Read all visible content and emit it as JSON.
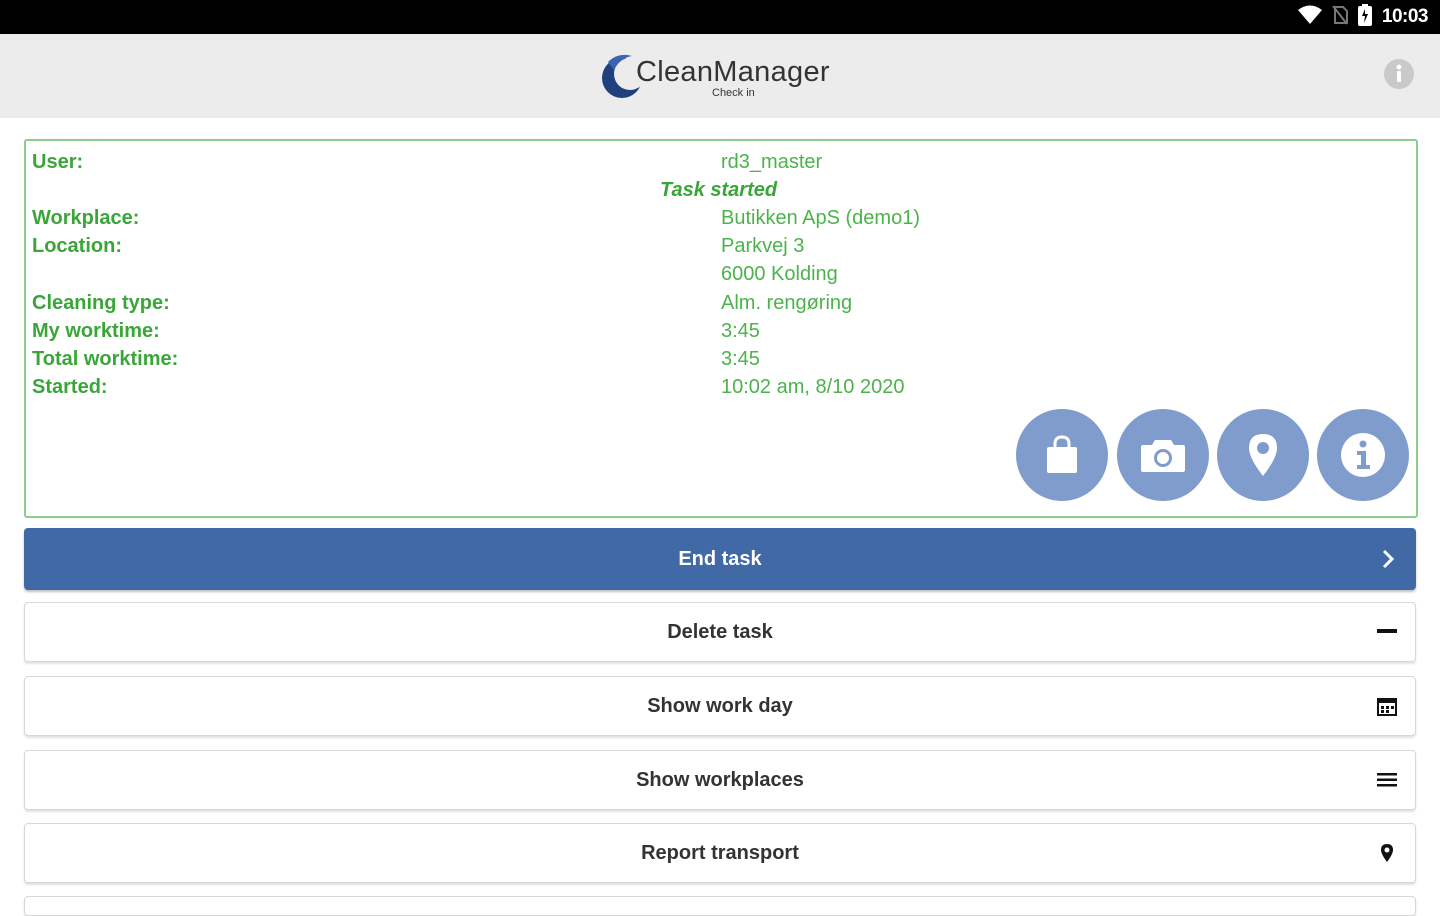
{
  "status_bar": {
    "time": "10:03",
    "icons": [
      "wifi-icon",
      "no-sim-icon",
      "battery-icon"
    ]
  },
  "header": {
    "logo_word": "CleanManager",
    "logo_subtitle": "Check in",
    "info_icon": "info-icon"
  },
  "task": {
    "status": "Task started",
    "fields": [
      {
        "label": "User:",
        "value": "rd3_master"
      },
      {
        "label": "Workplace:",
        "value": "Butikken ApS (demo1)"
      },
      {
        "label": "Location:",
        "value": "Parkvej 3"
      },
      {
        "label": "",
        "value": "6000 Kolding"
      },
      {
        "label": "Cleaning type:",
        "value": "Alm. rengøring"
      },
      {
        "label": "My worktime:",
        "value": "3:45"
      },
      {
        "label": "Total worktime:",
        "value": "3:45"
      },
      {
        "label": "Started:",
        "value": "10:02 am, 8/10 2020"
      }
    ],
    "quick_actions": [
      "shopping-bag-icon",
      "camera-icon",
      "map-pin-icon",
      "info-icon"
    ]
  },
  "actions": [
    {
      "label": "End task",
      "icon": "chevron-right-icon",
      "style": "primary"
    },
    {
      "label": "Delete task",
      "icon": "minus-icon",
      "style": "secondary"
    },
    {
      "label": "Show work day",
      "icon": "calendar-icon",
      "style": "secondary"
    },
    {
      "label": "Show workplaces",
      "icon": "list-icon",
      "style": "secondary"
    },
    {
      "label": "Report transport",
      "icon": "map-pin-icon",
      "style": "secondary"
    }
  ],
  "colors": {
    "primary": "#4169a6",
    "success_text": "#3aa63a",
    "card_border": "#8ccc8c",
    "quick_action_bg": "#7f9ccd"
  }
}
